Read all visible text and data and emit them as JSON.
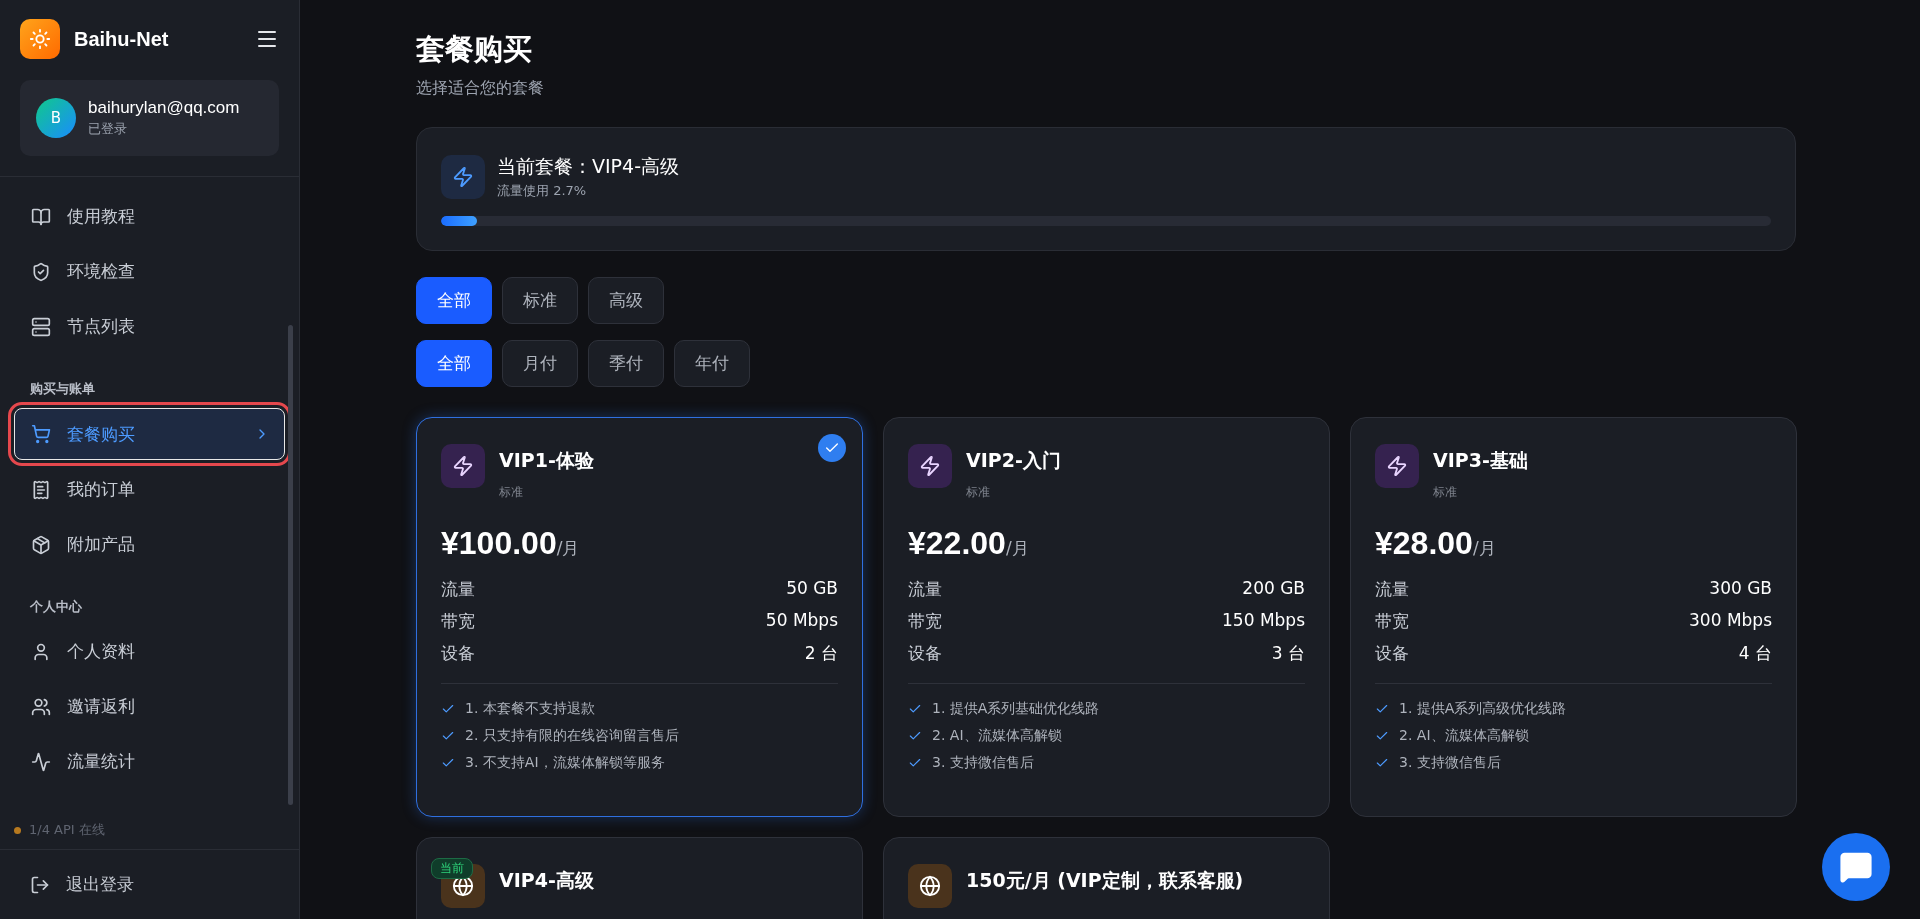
{
  "brand": {
    "name": "Baihu-Net"
  },
  "user": {
    "initial": "B",
    "email": "baihurylan@qq.com",
    "status": "已登录"
  },
  "sidebar": {
    "groups": [
      {
        "items": [
          {
            "label": "使用教程",
            "selected": false,
            "annotated": false
          },
          {
            "label": "环境检查",
            "selected": false,
            "annotated": false
          },
          {
            "label": "节点列表",
            "selected": false,
            "annotated": false
          }
        ]
      },
      {
        "label": "购买与账单",
        "items": [
          {
            "label": "套餐购买",
            "selected": true,
            "annotated": true
          },
          {
            "label": "我的订单",
            "selected": false,
            "annotated": false
          },
          {
            "label": "附加产品",
            "selected": false,
            "annotated": false
          }
        ]
      },
      {
        "label": "个人中心",
        "items": [
          {
            "label": "个人资料",
            "selected": false,
            "annotated": false
          },
          {
            "label": "邀请返利",
            "selected": false,
            "annotated": false
          },
          {
            "label": "流量统计",
            "selected": false,
            "annotated": false
          }
        ]
      }
    ],
    "api_status": "1/4 API 在线",
    "logout": "退出登录"
  },
  "page": {
    "title": "套餐购买",
    "subtitle": "选择适合您的套餐"
  },
  "current_plan": {
    "title": "当前套餐：VIP4-高级",
    "usage": "流量使用 2.7%",
    "level": 0.027
  },
  "filters": [
    [
      {
        "label": "全部",
        "selected": true
      },
      {
        "label": "标准",
        "selected": false
      },
      {
        "label": "高级",
        "selected": false
      }
    ],
    [
      {
        "label": "全部",
        "selected": true
      },
      {
        "label": "月付",
        "selected": false
      },
      {
        "label": "季付",
        "selected": false
      },
      {
        "label": "年付",
        "selected": false
      }
    ]
  ],
  "plans": [
    {
      "name": "VIP1-体验",
      "tier": "标准",
      "kind": "standard",
      "selected": true,
      "price": "¥100.00",
      "unit": "/月",
      "specs": [
        {
          "label": "流量",
          "value": "50 GB"
        },
        {
          "label": "带宽",
          "value": "50 Mbps"
        },
        {
          "label": "设备",
          "value": "2 台"
        }
      ],
      "features": [
        "1. 本套餐不支持退款",
        "2. 只支持有限的在线咨询留言售后",
        "3. 不支持AI，流媒体解锁等服务"
      ]
    },
    {
      "name": "VIP2-入门",
      "tier": "标准",
      "kind": "standard",
      "selected": false,
      "price": "¥22.00",
      "unit": "/月",
      "specs": [
        {
          "label": "流量",
          "value": "200 GB"
        },
        {
          "label": "带宽",
          "value": "150 Mbps"
        },
        {
          "label": "设备",
          "value": "3 台"
        }
      ],
      "features": [
        "1. 提供A系列基础优化线路",
        "2. AI、流媒体高解锁",
        "3. 支持微信售后"
      ]
    },
    {
      "name": "VIP3-基础",
      "tier": "标准",
      "kind": "standard",
      "selected": false,
      "price": "¥28.00",
      "unit": "/月",
      "specs": [
        {
          "label": "流量",
          "value": "300 GB"
        },
        {
          "label": "带宽",
          "value": "300 Mbps"
        },
        {
          "label": "设备",
          "value": "4 台"
        }
      ],
      "features": [
        "1. 提供A系列高级优化线路",
        "2. AI、流媒体高解锁",
        "3. 支持微信售后"
      ]
    },
    {
      "name": "VIP4-高级",
      "kind": "premium",
      "selected": false,
      "badge": "当前"
    },
    {
      "name": "150元/月 (VIP定制，联系客服)",
      "kind": "premium",
      "selected": false
    }
  ]
}
